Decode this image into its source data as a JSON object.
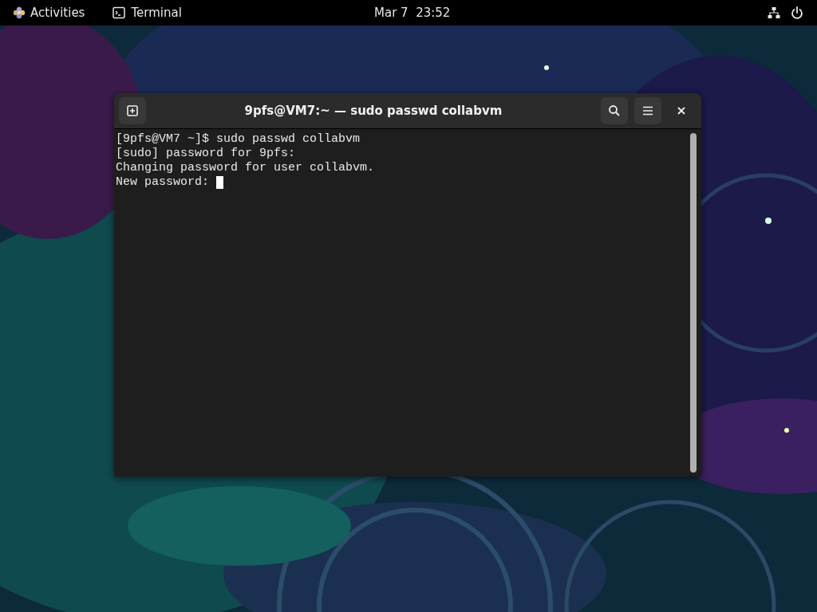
{
  "top_bar": {
    "activities": "Activities",
    "app_menu": "Terminal",
    "clock": "Mar 7  23:52"
  },
  "terminal_window": {
    "title": "9pfs@VM7:~ — sudo passwd collabvm",
    "lines": [
      "[9pfs@VM7 ~]$ sudo passwd collabvm",
      "[sudo] password for 9pfs:",
      "Changing password for user collabvm.",
      "New password: "
    ]
  }
}
